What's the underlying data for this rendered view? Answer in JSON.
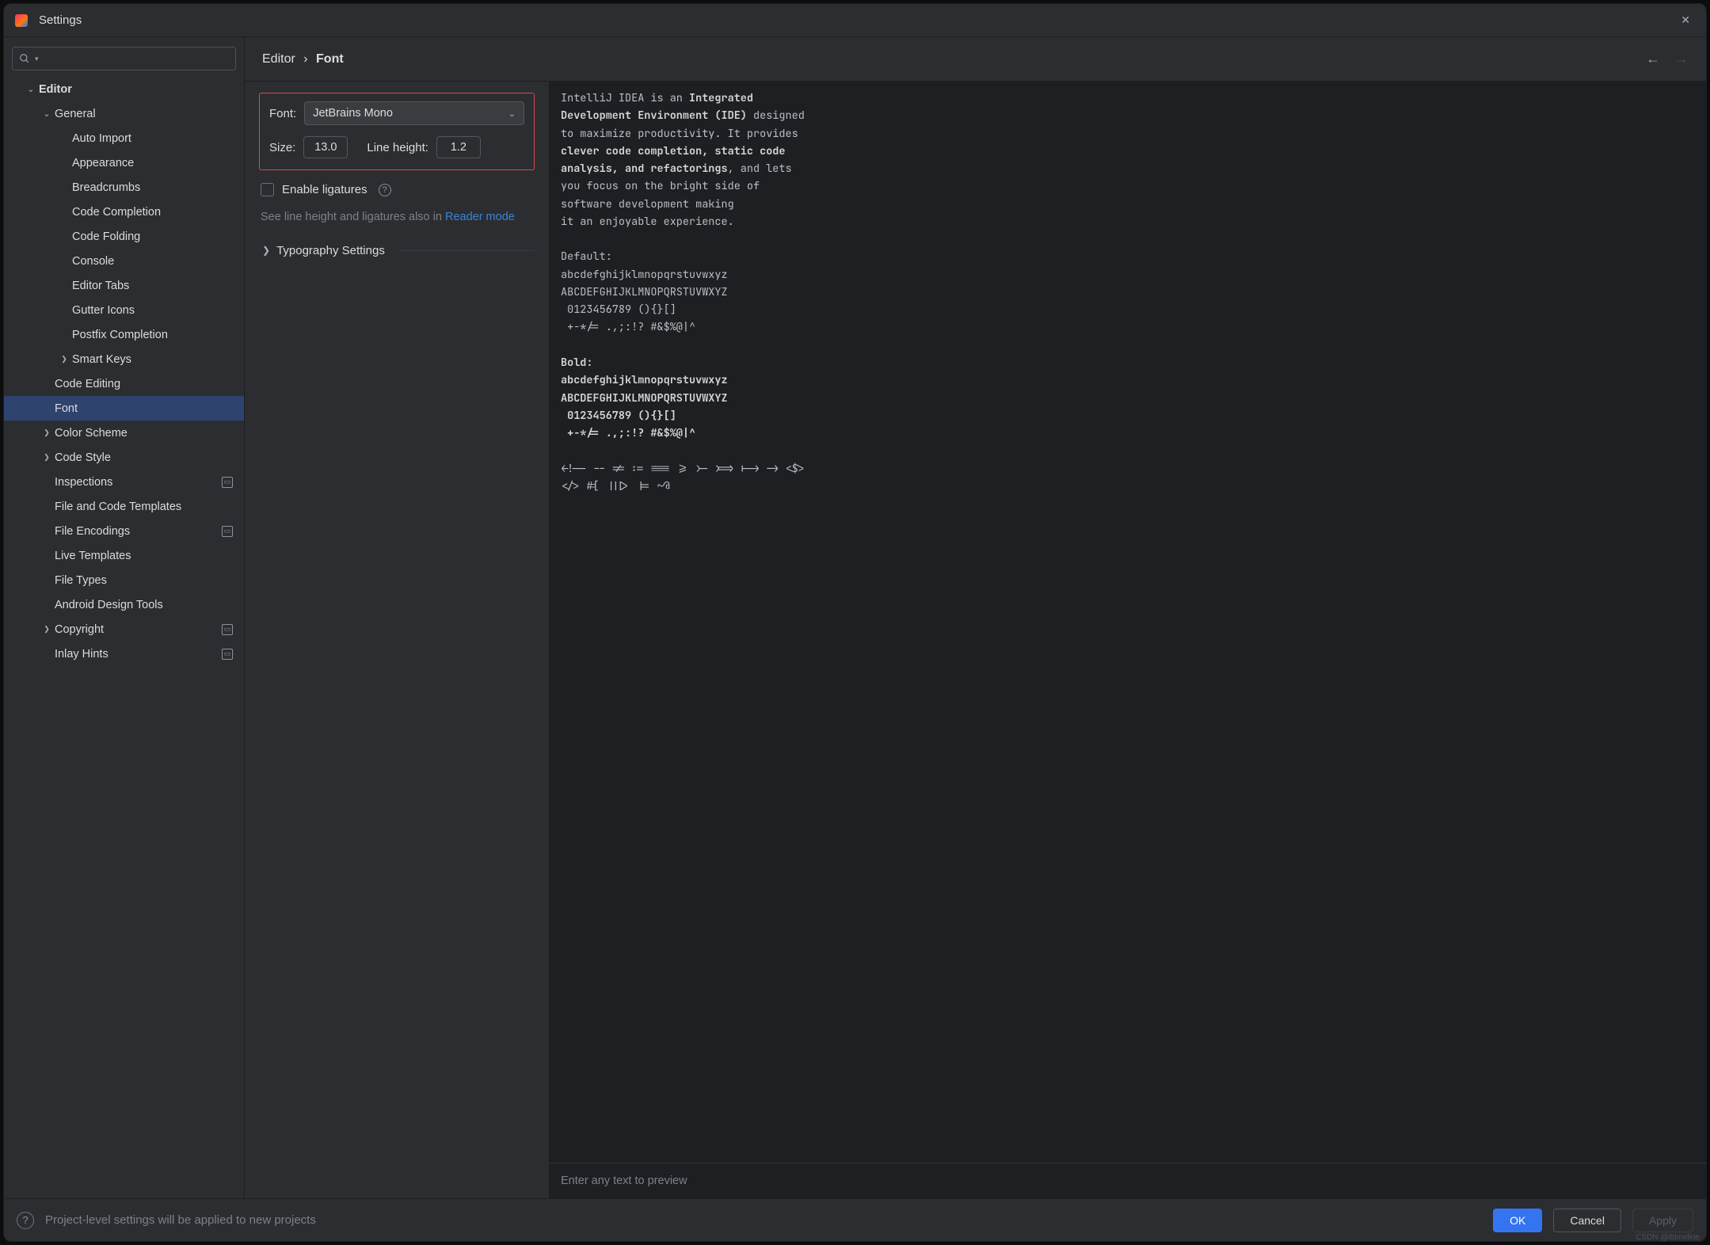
{
  "window": {
    "title": "Settings"
  },
  "header": {
    "crumb_parent": "Editor",
    "crumb_separator": "›",
    "crumb_leaf": "Font"
  },
  "sidebar": {
    "items": [
      {
        "label": "Editor",
        "depth": 0,
        "expand": "down",
        "badge": false
      },
      {
        "label": "General",
        "depth": 1,
        "expand": "down",
        "badge": false
      },
      {
        "label": "Auto Import",
        "depth": 2,
        "expand": "",
        "badge": false
      },
      {
        "label": "Appearance",
        "depth": 2,
        "expand": "",
        "badge": false
      },
      {
        "label": "Breadcrumbs",
        "depth": 2,
        "expand": "",
        "badge": false
      },
      {
        "label": "Code Completion",
        "depth": 2,
        "expand": "",
        "badge": false
      },
      {
        "label": "Code Folding",
        "depth": 2,
        "expand": "",
        "badge": false
      },
      {
        "label": "Console",
        "depth": 2,
        "expand": "",
        "badge": false
      },
      {
        "label": "Editor Tabs",
        "depth": 2,
        "expand": "",
        "badge": false
      },
      {
        "label": "Gutter Icons",
        "depth": 2,
        "expand": "",
        "badge": false
      },
      {
        "label": "Postfix Completion",
        "depth": 2,
        "expand": "",
        "badge": false
      },
      {
        "label": "Smart Keys",
        "depth": 2,
        "expand": "right",
        "badge": false
      },
      {
        "label": "Code Editing",
        "depth": 1,
        "expand": "",
        "badge": false
      },
      {
        "label": "Font",
        "depth": 1,
        "expand": "",
        "badge": false,
        "selected": true
      },
      {
        "label": "Color Scheme",
        "depth": 1,
        "expand": "right",
        "badge": false
      },
      {
        "label": "Code Style",
        "depth": 1,
        "expand": "right",
        "badge": false
      },
      {
        "label": "Inspections",
        "depth": 1,
        "expand": "",
        "badge": true
      },
      {
        "label": "File and Code Templates",
        "depth": 1,
        "expand": "",
        "badge": false
      },
      {
        "label": "File Encodings",
        "depth": 1,
        "expand": "",
        "badge": true
      },
      {
        "label": "Live Templates",
        "depth": 1,
        "expand": "",
        "badge": false
      },
      {
        "label": "File Types",
        "depth": 1,
        "expand": "",
        "badge": false
      },
      {
        "label": "Android Design Tools",
        "depth": 1,
        "expand": "",
        "badge": false
      },
      {
        "label": "Copyright",
        "depth": 1,
        "expand": "right",
        "badge": true
      },
      {
        "label": "Inlay Hints",
        "depth": 1,
        "expand": "",
        "badge": true
      }
    ]
  },
  "form": {
    "font_label": "Font:",
    "font_value": "JetBrains Mono",
    "size_label": "Size:",
    "size_value": "13.0",
    "line_height_label": "Line height:",
    "line_height_value": "1.2",
    "ligatures_label": "Enable ligatures",
    "hint_prefix": "See line height and ligatures also in ",
    "hint_link": "Reader mode",
    "typography_label": "Typography Settings"
  },
  "preview": {
    "text_intro_1a": "IntelliJ IDEA is an ",
    "text_intro_1b": "Integrated",
    "text_intro_2a": "Development Environment (IDE)",
    "text_intro_2b": " designed",
    "text_intro_3": "to maximize productivity. It provides",
    "text_intro_4a": "clever code completion, static code",
    "text_intro_5a": "analysis, and refactorings",
    "text_intro_5b": ", and lets",
    "text_intro_6": "you focus on the bright side of",
    "text_intro_7": "software development making",
    "text_intro_8": "it an enjoyable experience.",
    "default_label": "Default:",
    "sample_lc": "abcdefghijklmnopqrstuvwxyz",
    "sample_uc": "ABCDEFGHIJKLMNOPQRSTUVWXYZ",
    "sample_num": " 0123456789 (){}[]",
    "sample_sym": " +-*/= .,;:!? #&$%@|^",
    "bold_label": "Bold:",
    "ops_1": "<!-- -- != := === >= >- >=> |-> -> <$>",
    "ops_2": "</> #[ |||> |= ~@",
    "footer_placeholder": "Enter any text to preview"
  },
  "bottom": {
    "hint": "Project-level settings will be applied to new projects",
    "ok": "OK",
    "cancel": "Cancel",
    "apply": "Apply"
  },
  "watermark": "CSDN @ittimeline"
}
